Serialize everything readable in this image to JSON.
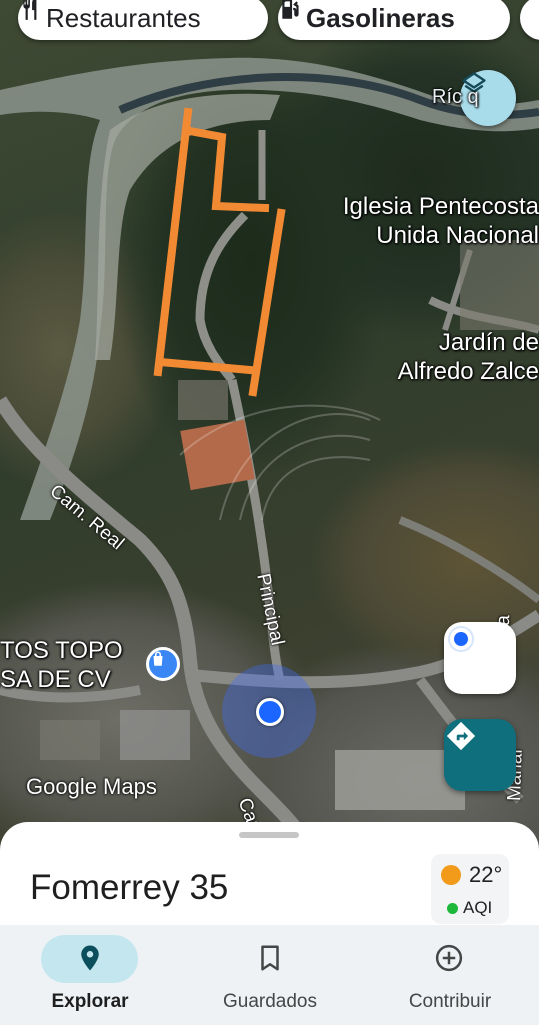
{
  "chips": [
    {
      "label": "Restaurantes",
      "icon": "fork-knife-icon"
    },
    {
      "label": "Gasolineras",
      "icon": "gas-station-icon"
    }
  ],
  "map": {
    "labels": {
      "iglesia": "Iglesia Pentecosta\nUnida Nacional",
      "jardin": "Jardín de\nAlfredo Zalce",
      "topo": "TOS TOPO\nSA DE CV",
      "rio": "Ríc  q"
    },
    "streets": {
      "cam_real": "Cam. Real",
      "principal": "Principal",
      "cam2": "Cam",
      "right1": "rrilla",
      "right2": "Mariar"
    },
    "attribution": "Google Maps",
    "colors": {
      "boundary": "#f28a33",
      "location": "#1a66ff"
    }
  },
  "place": {
    "title": "Fomerrey 35",
    "weather": {
      "temp": "22°",
      "aqi": "AQI"
    }
  },
  "nav": [
    {
      "label": "Explorar",
      "icon": "location-pin-icon",
      "active": true
    },
    {
      "label": "Guardados",
      "icon": "bookmark-icon",
      "active": false
    },
    {
      "label": "Contribuir",
      "icon": "add-circle-icon",
      "active": false
    }
  ]
}
